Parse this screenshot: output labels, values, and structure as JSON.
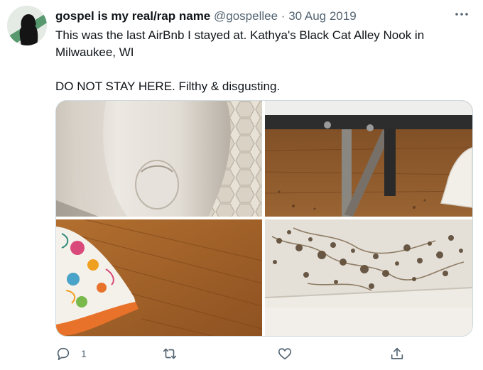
{
  "tweet": {
    "author": {
      "name": "gospel is my real/rap name",
      "handle": "@gospellee",
      "separator": "·",
      "date": "30 Aug 2019"
    },
    "text_lines": [
      "This was the last AirBnb I stayed at.  Kathya's Black Cat Alley Nook in Milwaukee, WI",
      "DO NOT STAY HERE. Filthy & disgusting."
    ],
    "media": {
      "photos": [
        "toilet-photo",
        "bed-frame-photo",
        "floor-pillow-photo",
        "stained-ceiling-photo"
      ]
    },
    "actions": {
      "reply_count": "1",
      "icons": [
        "reply-icon",
        "retweet-icon",
        "like-icon",
        "share-icon"
      ]
    }
  },
  "colors": {
    "text": "#0f1419",
    "secondary": "#536471",
    "border": "#cfd9de"
  }
}
